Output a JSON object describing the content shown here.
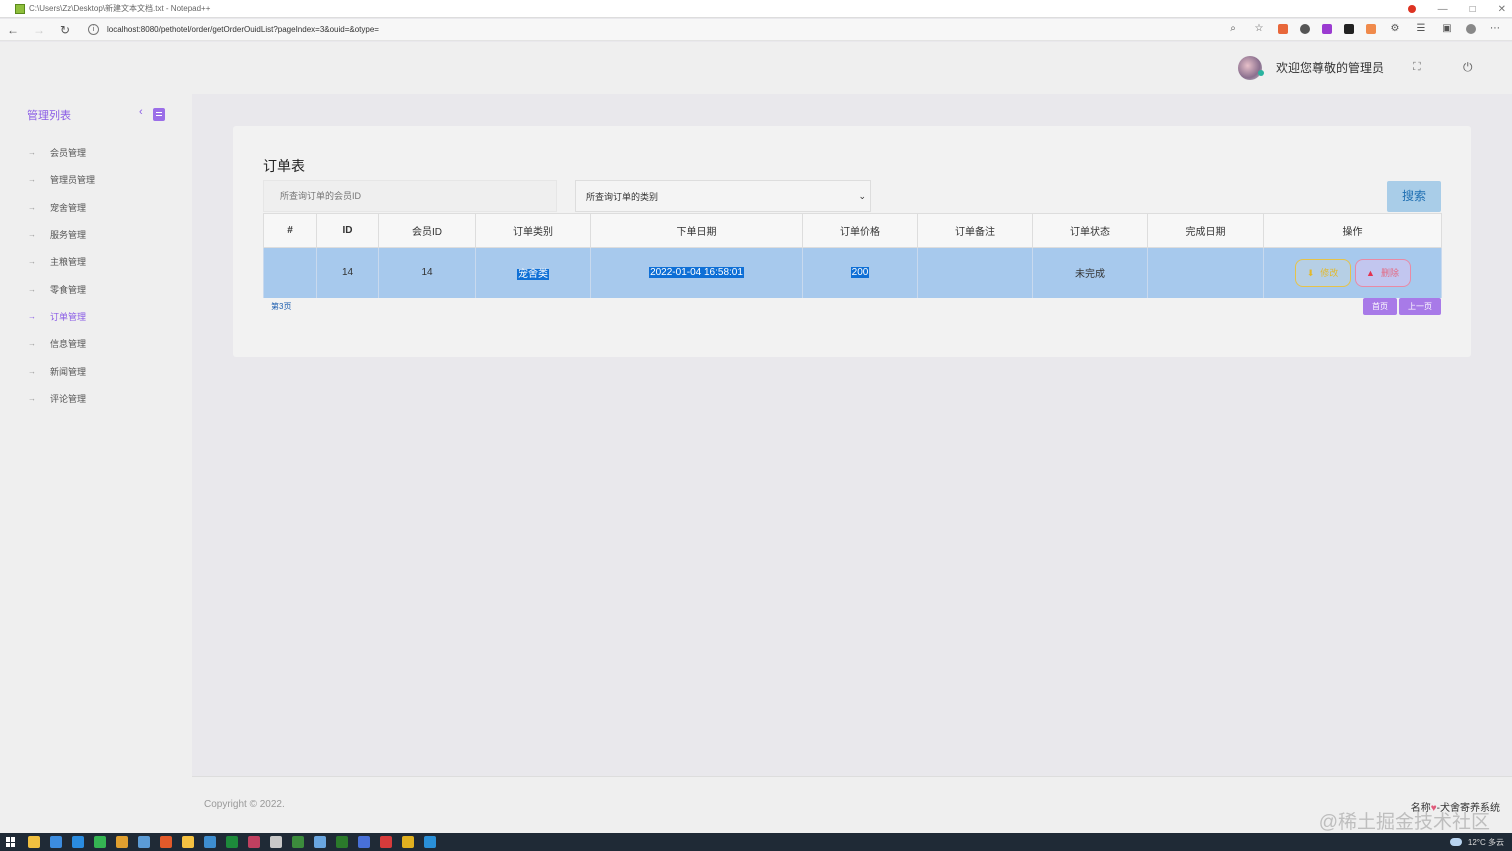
{
  "window": {
    "title": "C:\\Users\\Zz\\Desktop\\新建文本文档.txt - Notepad++",
    "controls": [
      "—",
      "□",
      "✕"
    ]
  },
  "browser": {
    "url": "localhost:8080/pethotel/order/getOrderOuidList?pageIndex=3&ouid=&otype=",
    "back": "←",
    "forward": "→",
    "reload": "↻",
    "info": "i",
    "more": "⋯"
  },
  "header": {
    "welcome": "欢迎您尊敬的管理员",
    "fullscreen_glyph": "⛶",
    "power_glyph": "⏻"
  },
  "sidebar": {
    "title": "管理列表",
    "collapse_glyph": "‹",
    "items": [
      {
        "label": "会员管理"
      },
      {
        "label": "管理员管理"
      },
      {
        "label": "宠舍管理"
      },
      {
        "label": "服务管理"
      },
      {
        "label": "主粮管理"
      },
      {
        "label": "零食管理"
      },
      {
        "label": "订单管理",
        "active": true
      },
      {
        "label": "信息管理"
      },
      {
        "label": "新闻管理"
      },
      {
        "label": "评论管理"
      }
    ],
    "arrow_glyph": "→"
  },
  "main": {
    "title": "订单表",
    "search_placeholder": "所查询订单的会员ID",
    "type_select_value": "所查询订单的类别",
    "select_chevron": "⌄",
    "search_button": "搜索",
    "table": {
      "columns": [
        "#",
        "ID",
        "会员ID",
        "订单类别",
        "下单日期",
        "订单价格",
        "订单备注",
        "订单状态",
        "完成日期",
        "操作"
      ],
      "rows": [
        {
          "index": "",
          "id": "14",
          "member_id": "14",
          "type": "宠舍类",
          "date": "2022-01-04 16:58:01",
          "price": "200",
          "note": "",
          "status": "未完成",
          "finish_date": "",
          "edit_label": "修改",
          "delete_label": "删除"
        }
      ]
    },
    "page_indicator": "第3页",
    "first_page": "首页",
    "prev_page": "上一页"
  },
  "footer": {
    "copyright": "Copyright © 2022.",
    "system_name_prefix": "名称",
    "system_name": "-犬舍寄养系统",
    "watermark": "@稀土掘金技术社区"
  },
  "taskbar": {
    "weather": "12°C 多云",
    "icon_colors": [
      "#f0c040",
      "#3c8de0",
      "#2a8ce0",
      "#35b553",
      "#e0a030",
      "#5b9bd5",
      "#e25a2a",
      "#f5c242",
      "#3e8ed0",
      "#1d8a3b",
      "#c04060",
      "#c8c8c8",
      "#3c8c3c",
      "#6aa6e0",
      "#2b7a2b",
      "#4870d8",
      "#d63b3b",
      "#e0b020",
      "#2a90d8"
    ]
  },
  "colors": {
    "accent_purple": "#8a5ce6",
    "row_highlight": "#a7c9ed",
    "search_button_bg": "#a9cde8",
    "page_button_bg": "#a87ae8"
  }
}
